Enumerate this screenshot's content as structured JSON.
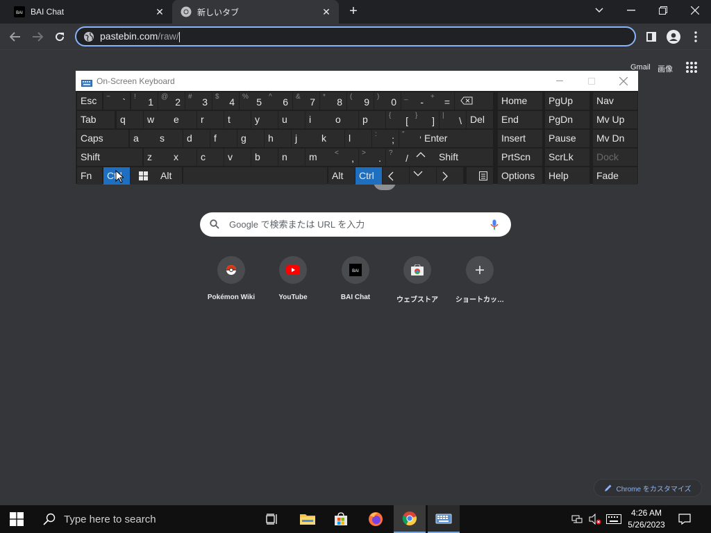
{
  "tabs": [
    {
      "title": "BAI Chat",
      "favicon": "bai-logo-icon",
      "active": false
    },
    {
      "title": "新しいタブ",
      "favicon": "chrome-icon",
      "active": true
    }
  ],
  "toolbar": {
    "url_host": "pastebin.com",
    "url_path": "/raw/"
  },
  "ntp": {
    "links": {
      "gmail": "Gmail",
      "images": "画像"
    },
    "search_placeholder": "Google で検索または URL を入力",
    "shortcuts": [
      {
        "label": "Pokémon Wiki",
        "icon": "pokeball-icon"
      },
      {
        "label": "YouTube",
        "icon": "youtube-icon"
      },
      {
        "label": "BAI Chat",
        "icon": "bai-logo-icon"
      },
      {
        "label": "ウェブストア",
        "icon": "webstore-icon"
      },
      {
        "label": "ショートカッ…",
        "icon": "plus-icon"
      }
    ],
    "customize_label": "Chrome をカスタマイズ"
  },
  "osk": {
    "title": "On-Screen Keyboard",
    "rows": [
      [
        {
          "main": "Esc"
        },
        {
          "main": "`",
          "sup": "~"
        },
        {
          "main": "1",
          "sup": "!"
        },
        {
          "main": "2",
          "sup": "@"
        },
        {
          "main": "3",
          "sup": "#"
        },
        {
          "main": "4",
          "sup": "$"
        },
        {
          "main": "5",
          "sup": "%"
        },
        {
          "main": "6",
          "sup": "^"
        },
        {
          "main": "7",
          "sup": "&"
        },
        {
          "main": "8",
          "sup": "*"
        },
        {
          "main": "9",
          "sup": "("
        },
        {
          "main": "0",
          "sup": ")"
        },
        {
          "main": "-",
          "sup": "_"
        },
        {
          "main": "=",
          "sup": "+"
        },
        {
          "main": "",
          "icon": "backspace-icon"
        }
      ],
      [
        {
          "main": "Tab"
        },
        {
          "main": "q"
        },
        {
          "main": "w"
        },
        {
          "main": "e"
        },
        {
          "main": "r"
        },
        {
          "main": "t"
        },
        {
          "main": "y"
        },
        {
          "main": "u"
        },
        {
          "main": "i"
        },
        {
          "main": "o"
        },
        {
          "main": "p"
        },
        {
          "main": "[",
          "sup": "{"
        },
        {
          "main": "]",
          "sup": "}"
        },
        {
          "main": "\\",
          "sup": "|"
        },
        {
          "main": "Del"
        }
      ],
      [
        {
          "main": "Caps"
        },
        {
          "main": "a"
        },
        {
          "main": "s"
        },
        {
          "main": "d"
        },
        {
          "main": "f"
        },
        {
          "main": "g"
        },
        {
          "main": "h"
        },
        {
          "main": "j"
        },
        {
          "main": "k"
        },
        {
          "main": "l"
        },
        {
          "main": ";",
          "sup": ":"
        },
        {
          "main": "'",
          "sup": "\""
        },
        {
          "main": "Enter"
        }
      ],
      [
        {
          "main": "Shift"
        },
        {
          "main": "z"
        },
        {
          "main": "x"
        },
        {
          "main": "c"
        },
        {
          "main": "v"
        },
        {
          "main": "b"
        },
        {
          "main": "n"
        },
        {
          "main": "m"
        },
        {
          "main": ",",
          "sup": "<"
        },
        {
          "main": ".",
          "sup": ">"
        },
        {
          "main": "/",
          "sup": "?"
        },
        {
          "main": "",
          "icon": "arrow-up-icon"
        },
        {
          "main": "Shift"
        }
      ],
      [
        {
          "main": "Fn"
        },
        {
          "main": "Ctrl",
          "selected": true
        },
        {
          "main": "",
          "icon": "windows-icon"
        },
        {
          "main": "Alt"
        },
        {
          "main": ""
        },
        {
          "main": "Alt"
        },
        {
          "main": "Ctrl",
          "selected": true
        },
        {
          "main": "",
          "icon": "arrow-left-icon"
        },
        {
          "main": "",
          "icon": "arrow-down-icon"
        },
        {
          "main": "",
          "icon": "arrow-right-icon"
        },
        {
          "main": "",
          "icon": "menu-key-icon"
        }
      ]
    ],
    "nav_rows": [
      [
        "Home",
        "PgUp",
        "Nav"
      ],
      [
        "End",
        "PgDn",
        "Mv Up"
      ],
      [
        "Insert",
        "Pause",
        "Mv Dn"
      ],
      [
        "PrtScn",
        "ScrLk",
        "Dock"
      ],
      [
        "Options",
        "Help",
        "Fade"
      ]
    ]
  },
  "taskbar": {
    "search_placeholder": "Type here to search",
    "time": "4:26 AM",
    "date": "5/26/2023"
  }
}
